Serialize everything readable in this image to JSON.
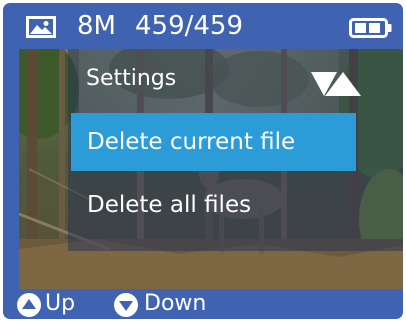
{
  "status": {
    "resolution": "8M",
    "file_counter": "459/459",
    "mode_icon": "image-icon",
    "battery_icon": "battery-icon"
  },
  "menu": {
    "title": "Settings",
    "nav_icon": "up-down-triangle-icon",
    "items": [
      {
        "label": "Delete current file",
        "selected": true
      },
      {
        "label": "Delete all files",
        "selected": false
      }
    ]
  },
  "footer": {
    "up_label": "Up",
    "down_label": "Down"
  },
  "colors": {
    "frame": "#3f63b0",
    "highlight": "#2b9cd8",
    "text": "#ffffff"
  }
}
